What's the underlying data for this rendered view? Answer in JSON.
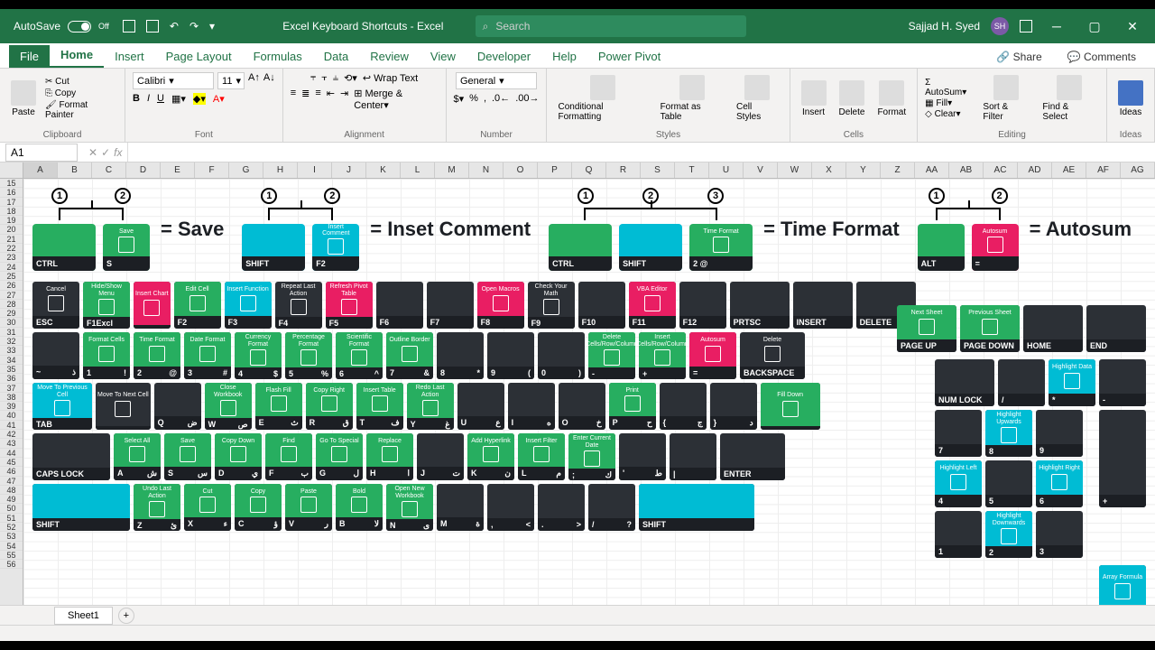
{
  "titlebar": {
    "autosave": "AutoSave",
    "autosave_state": "Off",
    "title": "Excel Keyboard Shortcuts - Excel",
    "search_placeholder": "Search",
    "user": "Sajjad H. Syed",
    "user_initials": "SH"
  },
  "tabs": [
    "File",
    "Home",
    "Insert",
    "Page Layout",
    "Formulas",
    "Data",
    "Review",
    "View",
    "Developer",
    "Help",
    "Power Pivot"
  ],
  "tabs_right": {
    "share": "Share",
    "comments": "Comments"
  },
  "ribbon": {
    "clipboard": {
      "paste": "Paste",
      "cut": "Cut",
      "copy": "Copy",
      "painter": "Format Painter",
      "label": "Clipboard"
    },
    "font": {
      "name": "Calibri",
      "size": "11",
      "label": "Font"
    },
    "alignment": {
      "wrap": "Wrap Text",
      "merge": "Merge & Center",
      "label": "Alignment"
    },
    "number": {
      "format": "General",
      "label": "Number"
    },
    "styles": {
      "cond": "Conditional Formatting",
      "table": "Format as Table",
      "cell": "Cell Styles",
      "label": "Styles"
    },
    "cells": {
      "insert": "Insert",
      "delete": "Delete",
      "format": "Format",
      "label": "Cells"
    },
    "editing": {
      "autosum": "AutoSum",
      "fill": "Fill",
      "clear": "Clear",
      "sort": "Sort & Filter",
      "find": "Find & Select",
      "label": "Editing"
    },
    "ideas": {
      "label": "Ideas"
    }
  },
  "formulabar": {
    "cell": "A1",
    "fx": "fx"
  },
  "columns": [
    "A",
    "B",
    "C",
    "D",
    "E",
    "F",
    "G",
    "H",
    "I",
    "J",
    "K",
    "L",
    "M",
    "N",
    "O",
    "P",
    "Q",
    "R",
    "S",
    "T",
    "U",
    "V",
    "W",
    "X",
    "Y",
    "Z",
    "AA",
    "AB",
    "AC",
    "AD",
    "AE",
    "AF",
    "AG"
  ],
  "row_start": 15,
  "row_end": 56,
  "shortcuts": [
    {
      "nums": [
        "1",
        "2"
      ],
      "keys": [
        {
          "color": "green",
          "top": "",
          "label": "CTRL"
        },
        {
          "color": "green",
          "top": "Save",
          "label": "S"
        }
      ],
      "result": "= Save"
    },
    {
      "nums": [
        "1",
        "2"
      ],
      "keys": [
        {
          "color": "cyan",
          "top": "",
          "label": "SHIFT"
        },
        {
          "color": "cyan",
          "top": "Insert Comment",
          "label": "F2"
        }
      ],
      "result": "= Inset Comment"
    },
    {
      "nums": [
        "1",
        "2",
        "3"
      ],
      "keys": [
        {
          "color": "green",
          "top": "",
          "label": "CTRL"
        },
        {
          "color": "cyan",
          "top": "",
          "label": "SHIFT"
        },
        {
          "color": "green",
          "top": "Time Format",
          "label": "2    @"
        }
      ],
      "result": "= Time Format"
    },
    {
      "nums": [
        "1",
        "2"
      ],
      "keys": [
        {
          "color": "green",
          "top": "",
          "label": "ALT"
        },
        {
          "color": "pink",
          "top": "Autosum",
          "label": "="
        }
      ],
      "result": "= Autosum"
    }
  ],
  "row_fn": [
    {
      "c": "dark",
      "t": "Cancel",
      "b": "ESC",
      "w": "w1"
    },
    {
      "c": "green",
      "t": "Hide/Show Menu",
      "b": "F1",
      "b2": "Excl Help",
      "w": "w1"
    },
    {
      "c": "pink",
      "t": "Insert Chart",
      "b": "",
      "w": "w05"
    },
    {
      "c": "green",
      "t": "Edit Cell",
      "b": "F2",
      "w": "w1"
    },
    {
      "c": "cyan",
      "t": "Insert Function",
      "b": "F3",
      "w": "w1"
    },
    {
      "c": "dark",
      "t": "Repeat Last Action",
      "b": "F4",
      "w": "w1"
    },
    {
      "c": "pink",
      "t": "Refresh Pivot Table",
      "b": "F5",
      "w": "w1"
    },
    {
      "c": "dark",
      "t": "",
      "b": "F6",
      "w": "w1"
    },
    {
      "c": "dark",
      "t": "",
      "b": "F7",
      "w": "w1"
    },
    {
      "c": "pink",
      "t": "Open Macros",
      "b": "F8",
      "w": "w1"
    },
    {
      "c": "dark",
      "t": "Check Your Math",
      "b": "F9",
      "w": "w1"
    },
    {
      "c": "dark",
      "t": "",
      "b": "F10",
      "w": "w1"
    },
    {
      "c": "pink",
      "t": "VBA Editor",
      "b": "F11",
      "w": "w1"
    },
    {
      "c": "dark",
      "t": "",
      "b": "F12",
      "w": "w1"
    },
    {
      "c": "dark",
      "t": "",
      "b": "PRTSC",
      "w": "w15"
    },
    {
      "c": "dark",
      "t": "",
      "b": "INSERT",
      "w": "w15"
    },
    {
      "c": "dark",
      "t": "",
      "b": "DELETE",
      "w": "w15"
    }
  ],
  "row_num": [
    {
      "c": "dark",
      "t": "",
      "b": "~",
      "b2": "ذ",
      "w": "w1"
    },
    {
      "c": "green",
      "t": "Format Cells",
      "b": "1",
      "b2": "!",
      "w": "w1"
    },
    {
      "c": "green",
      "t": "Time Format",
      "b": "2",
      "b2": "@",
      "w": "w1"
    },
    {
      "c": "green",
      "t": "Date Format",
      "b": "3",
      "b2": "#",
      "w": "w1"
    },
    {
      "c": "green",
      "t": "Currency Format",
      "b": "4",
      "b2": "$",
      "w": "w1"
    },
    {
      "c": "green",
      "t": "Percentage Format",
      "b": "5",
      "b2": "%",
      "w": "w1"
    },
    {
      "c": "green",
      "t": "Scientific Format",
      "b": "6",
      "b2": "^",
      "w": "w1"
    },
    {
      "c": "green",
      "t": "Outline Border",
      "b": "7",
      "b2": "&",
      "w": "w1"
    },
    {
      "c": "dark",
      "t": "",
      "b": "8",
      "b2": "*",
      "w": "w1"
    },
    {
      "c": "dark",
      "t": "",
      "b": "9",
      "b2": "(",
      "w": "w1"
    },
    {
      "c": "dark",
      "t": "",
      "b": "0",
      "b2": ")",
      "w": "w1"
    },
    {
      "c": "green",
      "t": "Delete Cells/Row/Column",
      "b": "-",
      "b2": "",
      "w": "w1"
    },
    {
      "c": "green",
      "t": "Insert Cells/Row/Column",
      "b": "+",
      "b2": "",
      "w": "w1"
    },
    {
      "c": "pink",
      "t": "Autosum",
      "b": "=",
      "b2": "",
      "w": "w1"
    },
    {
      "c": "dark",
      "t": "Delete",
      "b": "BACKSPACE",
      "w": "w2"
    }
  ],
  "row_qwerty": [
    {
      "c": "cyan",
      "t": "Move To Previous Cell",
      "b": "TAB",
      "w": "w15"
    },
    {
      "c": "dark",
      "t": "Move To Next Cell",
      "b": "",
      "w": "w05"
    },
    {
      "c": "dark",
      "t": "",
      "b": "Q",
      "b2": "ض",
      "w": "w1"
    },
    {
      "c": "green",
      "t": "Close Workbook",
      "b": "W",
      "b2": "ص",
      "w": "w1"
    },
    {
      "c": "green",
      "t": "Flash Fill",
      "b": "E",
      "b2": "ث",
      "w": "w1"
    },
    {
      "c": "green",
      "t": "Copy Right",
      "b": "R",
      "b2": "ق",
      "w": "w1"
    },
    {
      "c": "green",
      "t": "Insert Table",
      "b": "T",
      "b2": "ف",
      "w": "w1"
    },
    {
      "c": "green",
      "t": "Redo Last Action",
      "b": "Y",
      "b2": "غ",
      "w": "w1"
    },
    {
      "c": "dark",
      "t": "",
      "b": "U",
      "b2": "ع",
      "w": "w1"
    },
    {
      "c": "dark",
      "t": "",
      "b": "I",
      "b2": "ه",
      "w": "w1"
    },
    {
      "c": "dark",
      "t": "",
      "b": "O",
      "b2": "خ",
      "w": "w1"
    },
    {
      "c": "green",
      "t": "Print",
      "b": "P",
      "b2": "ح",
      "w": "w1"
    },
    {
      "c": "dark",
      "t": "",
      "b": "{",
      "b2": "ج",
      "w": "w1"
    },
    {
      "c": "dark",
      "t": "",
      "b": "}",
      "b2": "د",
      "w": "w1"
    },
    {
      "c": "green",
      "t": "Fill Down",
      "b": "",
      "w": "w15"
    }
  ],
  "row_asdf": [
    {
      "c": "dark",
      "t": "",
      "b": "CAPS LOCK",
      "w": "w25"
    },
    {
      "c": "green",
      "t": "Select All",
      "b": "A",
      "b2": "ش",
      "w": "w1"
    },
    {
      "c": "green",
      "t": "Save",
      "b": "S",
      "b2": "س",
      "w": "w1"
    },
    {
      "c": "green",
      "t": "Copy Down",
      "b": "D",
      "b2": "ي",
      "w": "w1"
    },
    {
      "c": "green",
      "t": "Find",
      "b": "F",
      "b2": "ب",
      "w": "w1"
    },
    {
      "c": "green",
      "t": "Go To Special",
      "b": "G",
      "b2": "ل",
      "w": "w1"
    },
    {
      "c": "green",
      "t": "Replace",
      "b": "H",
      "b2": "ا",
      "w": "w1"
    },
    {
      "c": "dark",
      "t": "",
      "b": "J",
      "b2": "ت",
      "w": "w1"
    },
    {
      "c": "green",
      "t": "Add Hyperlink",
      "b": "K",
      "b2": "ن",
      "w": "w1"
    },
    {
      "c": "green",
      "t": "Insert Filter",
      "b": "L",
      "b2": "م",
      "w": "w1"
    },
    {
      "c": "green",
      "t": "Enter Current Date",
      "b": ";",
      "b2": "ك",
      "w": "w1"
    },
    {
      "c": "dark",
      "t": "",
      "b": "'",
      "b2": "ط",
      "w": "w1"
    },
    {
      "c": "dark",
      "t": "",
      "b": "|",
      "b2": "",
      "w": "w1"
    },
    {
      "c": "dark",
      "t": "",
      "b": "ENTER",
      "w": "w2"
    }
  ],
  "row_zxcv": [
    {
      "c": "cyan",
      "t": "",
      "b": "SHIFT",
      "w": "w3"
    },
    {
      "c": "green",
      "t": "Undo Last Action",
      "b": "Z",
      "b2": "ئ",
      "w": "w1"
    },
    {
      "c": "green",
      "t": "Cut",
      "b": "X",
      "b2": "ء",
      "w": "w1"
    },
    {
      "c": "green",
      "t": "Copy",
      "b": "C",
      "b2": "ؤ",
      "w": "w1"
    },
    {
      "c": "green",
      "t": "Paste",
      "b": "V",
      "b2": "ر",
      "w": "w1"
    },
    {
      "c": "green",
      "t": "Bold",
      "b": "B",
      "b2": "لا",
      "w": "w1"
    },
    {
      "c": "green",
      "t": "Open New Workbook",
      "b": "N",
      "b2": "ى",
      "w": "w1"
    },
    {
      "c": "dark",
      "t": "",
      "b": "M",
      "b2": "ة",
      "w": "w1"
    },
    {
      "c": "dark",
      "t": "",
      "b": ",",
      "b2": "<",
      "w": "w1"
    },
    {
      "c": "dark",
      "t": "",
      "b": ".",
      "b2": ">",
      "w": "w1"
    },
    {
      "c": "dark",
      "t": "",
      "b": "/",
      "b2": "?",
      "w": "w1"
    },
    {
      "c": "cyan",
      "t": "",
      "b": "SHIFT",
      "w": "w4"
    }
  ],
  "nav_keys": [
    {
      "c": "green",
      "t": "Next Sheet",
      "b": "PAGE UP",
      "w": "w15"
    },
    {
      "c": "green",
      "t": "Previous Sheet",
      "b": "PAGE DOWN",
      "w": "w15"
    },
    {
      "c": "dark",
      "t": "",
      "b": "HOME",
      "w": "w15"
    },
    {
      "c": "dark",
      "t": "",
      "b": "END",
      "w": "w15"
    }
  ],
  "numpad": {
    "r1": [
      {
        "c": "dark",
        "t": "",
        "b": "NUM LOCK",
        "w": "w15"
      },
      {
        "c": "dark",
        "t": "",
        "b": "/",
        "w": "w1"
      },
      {
        "c": "cyan",
        "t": "Highlight Data",
        "b": "*",
        "w": "w1"
      },
      {
        "c": "dark",
        "t": "",
        "b": "-",
        "w": "w1"
      }
    ],
    "r2": [
      {
        "c": "dark",
        "t": "",
        "b": "7",
        "w": "w1"
      },
      {
        "c": "cyan",
        "t": "Highlight Upwards",
        "b": "8",
        "w": "w1"
      },
      {
        "c": "dark",
        "t": "",
        "b": "9",
        "w": "w1"
      }
    ],
    "r3": [
      {
        "c": "cyan",
        "t": "Highlight Left",
        "b": "4",
        "w": "w1"
      },
      {
        "c": "dark",
        "t": "",
        "b": "5",
        "w": "w1"
      },
      {
        "c": "cyan",
        "t": "Highlight Right",
        "b": "6",
        "w": "w1"
      }
    ],
    "r4": [
      {
        "c": "dark",
        "t": "",
        "b": "1",
        "w": "w1"
      },
      {
        "c": "cyan",
        "t": "Highlight Downwards",
        "b": "2",
        "w": "w1"
      },
      {
        "c": "dark",
        "t": "",
        "b": "3",
        "w": "w1"
      }
    ],
    "plus": {
      "c": "dark",
      "b": "+",
      "w": "w1"
    },
    "array": {
      "c": "cyan",
      "t": "Array Formula",
      "w": "w1"
    }
  },
  "sheettab": "Sheet1"
}
